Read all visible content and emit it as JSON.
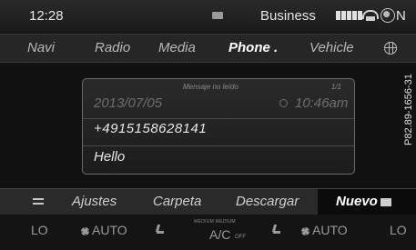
{
  "status": {
    "time": "12:28",
    "carrier": "Business"
  },
  "menu": {
    "items": [
      {
        "label": "Navi"
      },
      {
        "label": "Radio"
      },
      {
        "label": "Media"
      },
      {
        "label": "Phone ."
      },
      {
        "label": "Vehicle"
      }
    ],
    "active": "Phone"
  },
  "message": {
    "header": "Mensaje no leído",
    "page": "1/1",
    "date": "2013/07/05",
    "time": "10:46am",
    "sender": "+4915158628141",
    "text": "Hello"
  },
  "softkeys": {
    "items": [
      {
        "label": "Ajustes"
      },
      {
        "label": "Carpeta"
      },
      {
        "label": "Descargar"
      },
      {
        "label": "Nuevo"
      }
    ],
    "selected": "Nuevo"
  },
  "climate": {
    "left_temp": "LO",
    "left_fan": "AUTO",
    "ac_small": "MEDIUM MEDIUM",
    "ac_label": "A/C",
    "ac_sub": "OFF",
    "right_fan": "AUTO",
    "right_temp": "LO"
  },
  "image_code": "P82.89-1656-31",
  "icons": {
    "status": [
      "message-icon",
      "signal-icon",
      "phone-icon",
      "globe-icon"
    ],
    "menu": [
      "globe-icon"
    ],
    "softkeys": [
      "back-icon",
      "envelope-icon"
    ],
    "climate": [
      "fan-icon",
      "seat-heat-icon"
    ]
  }
}
